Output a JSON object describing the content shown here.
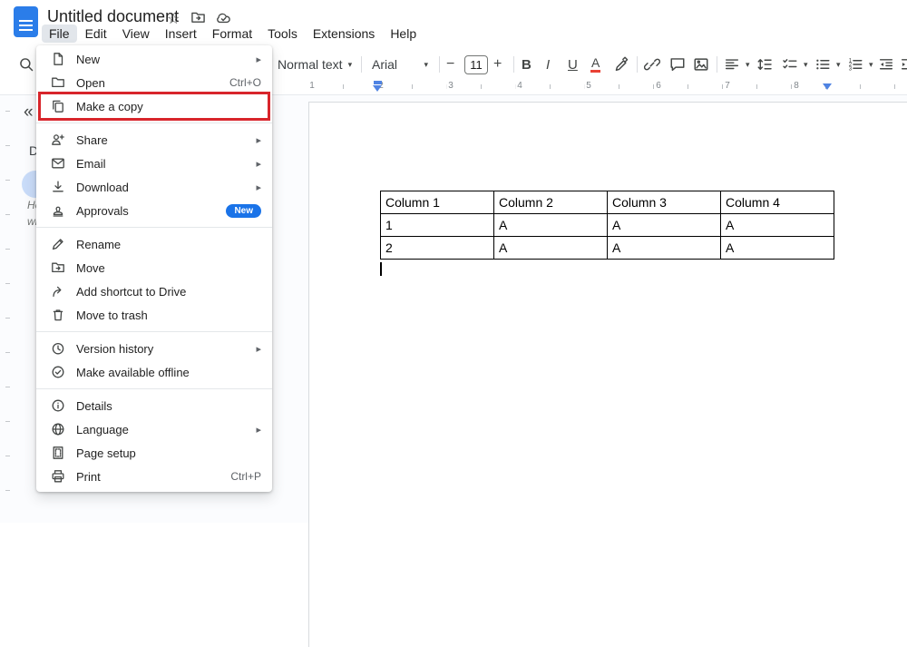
{
  "topbar": {
    "title": "Untitled document",
    "menus": [
      "File",
      "Edit",
      "View",
      "Insert",
      "Format",
      "Tools",
      "Extensions",
      "Help"
    ]
  },
  "glyphs": {
    "star": "☆",
    "submenu_arrow": "▸",
    "dropdown_caret": "▾",
    "minus": "−",
    "plus": "+",
    "collapse_chevrons": "«"
  },
  "toolbar": {
    "style": "Normal text",
    "font": "Arial",
    "size": "11",
    "bold": "B",
    "italic": "I",
    "underline": "U",
    "text_color": "A"
  },
  "file_menu": {
    "sections": [
      {
        "items": [
          {
            "label": "New",
            "icon": "new-document-icon",
            "submenu": true
          },
          {
            "label": "Open",
            "icon": "folder-open-icon",
            "shortcut": "Ctrl+O"
          },
          {
            "label": "Make a copy",
            "icon": "copy-icon",
            "highlighted": true
          }
        ]
      },
      {
        "items": [
          {
            "label": "Share",
            "icon": "share-person-icon",
            "submenu": true
          },
          {
            "label": "Email",
            "icon": "email-icon",
            "submenu": true
          },
          {
            "label": "Download",
            "icon": "download-icon",
            "submenu": true
          },
          {
            "label": "Approvals",
            "icon": "approvals-icon",
            "badge": "New"
          }
        ]
      },
      {
        "items": [
          {
            "label": "Rename",
            "icon": "rename-pencil-icon"
          },
          {
            "label": "Move",
            "icon": "move-folder-icon"
          },
          {
            "label": "Add shortcut to Drive",
            "icon": "add-shortcut-icon"
          },
          {
            "label": "Move to trash",
            "icon": "trash-icon"
          }
        ]
      },
      {
        "items": [
          {
            "label": "Version history",
            "icon": "version-history-icon",
            "submenu": true
          },
          {
            "label": "Make available offline",
            "icon": "offline-check-icon"
          }
        ]
      },
      {
        "items": [
          {
            "label": "Details",
            "icon": "info-icon"
          },
          {
            "label": "Language",
            "icon": "globe-icon",
            "submenu": true
          },
          {
            "label": "Page setup",
            "icon": "page-setup-icon"
          },
          {
            "label": "Print",
            "icon": "printer-icon",
            "shortcut": "Ctrl+P"
          }
        ]
      }
    ]
  },
  "ruler": {
    "numbers": [
      "1",
      "2",
      "3",
      "4",
      "5",
      "6",
      "7",
      "8"
    ]
  },
  "outline_panel": {
    "partial_heading": "D",
    "placeholder_lines": [
      "He",
      "wi"
    ]
  },
  "document": {
    "table": {
      "headers": [
        "Column 1",
        "Column 2",
        "Column 3",
        "Column 4"
      ],
      "rows": [
        [
          "1",
          "A",
          "A",
          "A"
        ],
        [
          "2",
          "A",
          "A",
          "A"
        ]
      ]
    }
  },
  "colors": {
    "docs_icon_blue": "#2b7de9",
    "badge_blue": "#1a73e8",
    "highlight_red": "#d8252b",
    "indent_marker_blue": "#4f83e3"
  }
}
